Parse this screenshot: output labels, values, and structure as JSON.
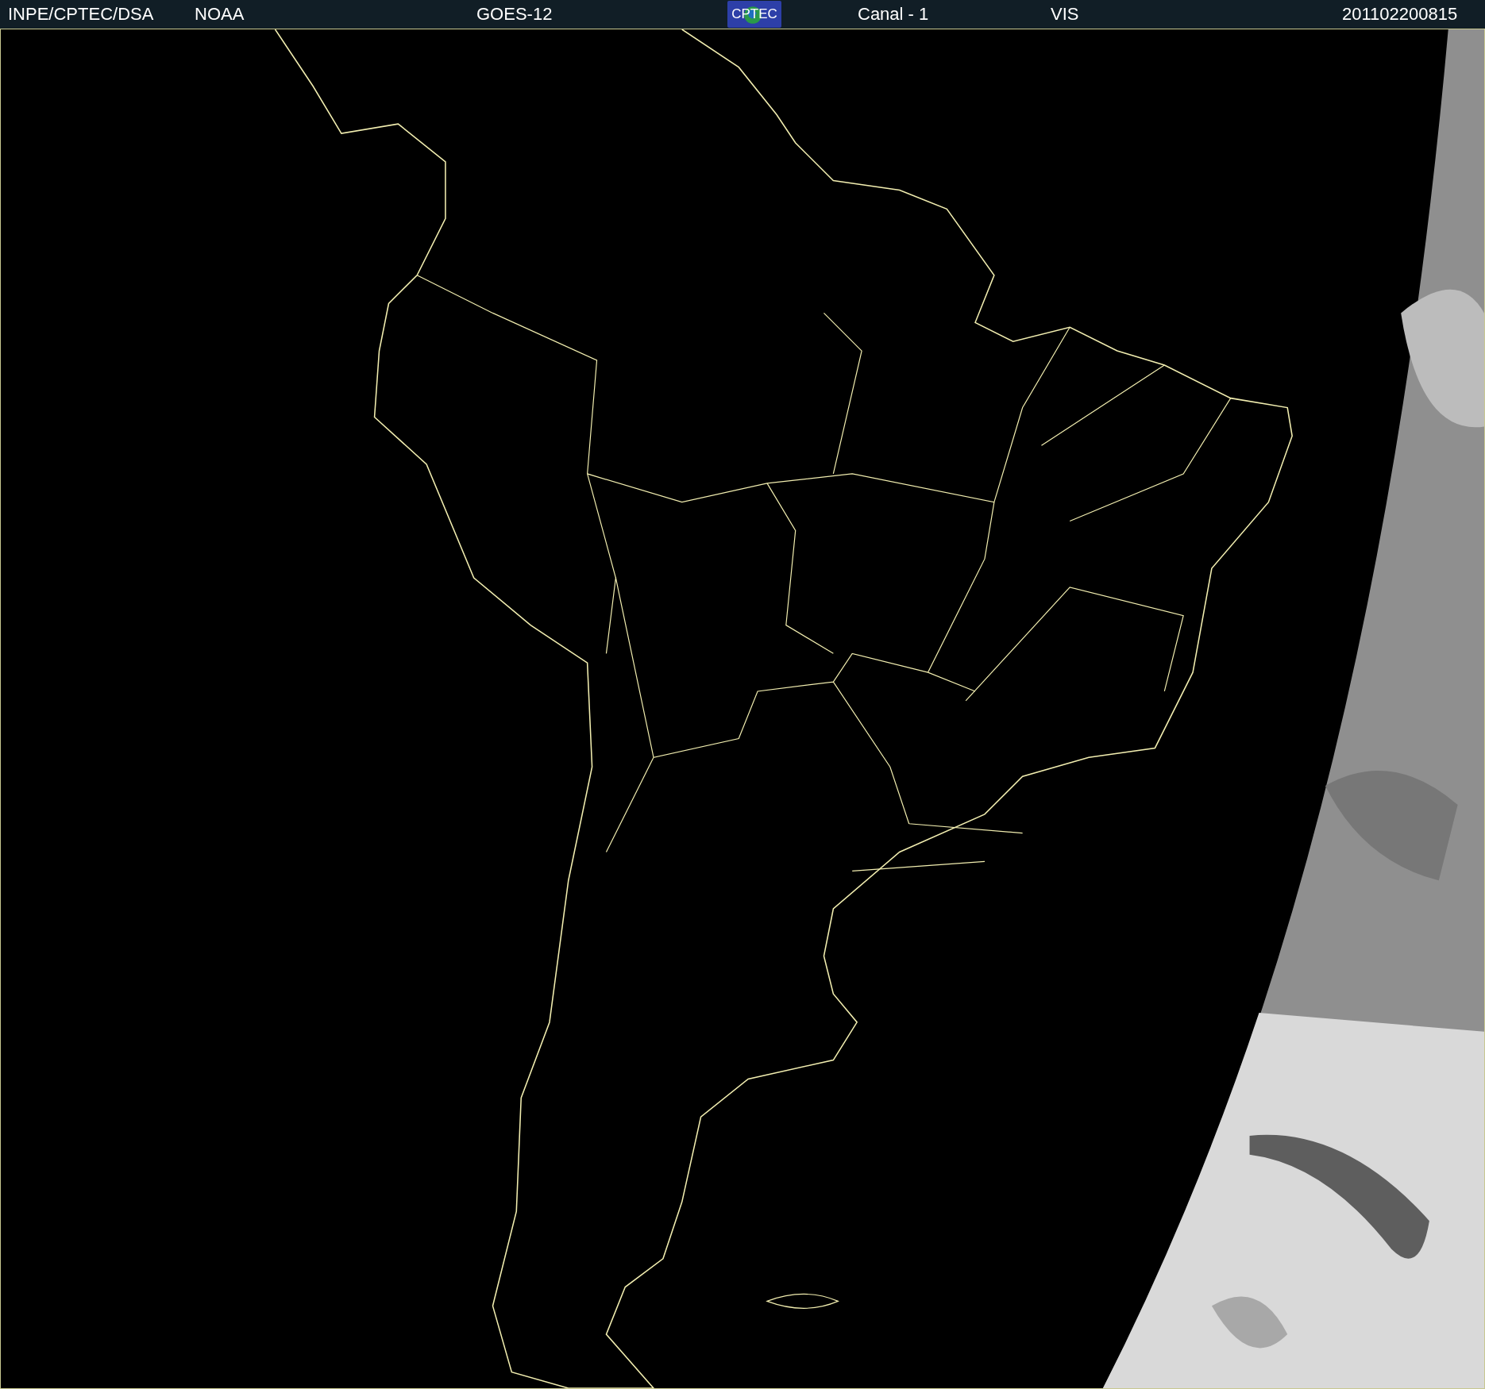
{
  "header": {
    "items": [
      {
        "kind": "text",
        "text": "INPE/CPTEC/DSA"
      },
      {
        "kind": "text",
        "text": "NOAA"
      },
      {
        "kind": "text",
        "text": "GOES-12"
      },
      {
        "kind": "logo",
        "text": "CPTEC"
      },
      {
        "kind": "text",
        "text": "Canal - 1"
      },
      {
        "kind": "text",
        "text": "VIS"
      },
      {
        "kind": "text",
        "text": "201102200815"
      }
    ]
  }
}
